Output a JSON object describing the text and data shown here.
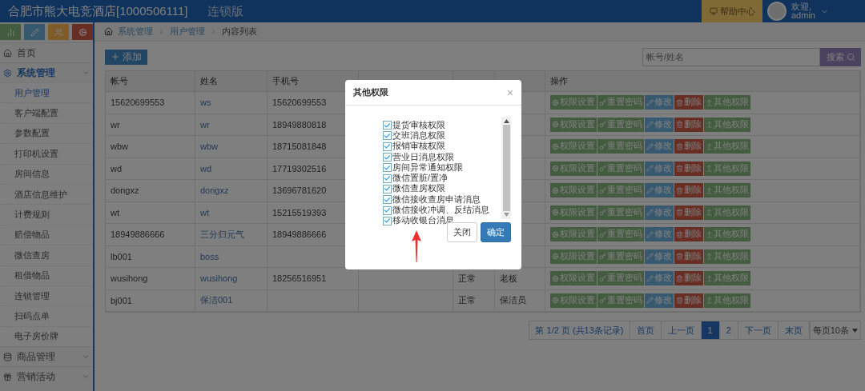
{
  "header": {
    "title": "合肥市熊大电竞酒店[1000506111]",
    "edition": "连锁版",
    "help": "帮助中心",
    "welcome": "欢迎,",
    "user": "admin"
  },
  "sidebar": {
    "shortcuts": [
      {
        "kind": "chart"
      },
      {
        "kind": "pencil"
      },
      {
        "kind": "users"
      },
      {
        "kind": "gears"
      }
    ],
    "items": [
      {
        "kind": "home",
        "label": "首页",
        "expanded": false
      },
      {
        "kind": "gear",
        "label": "系统管理",
        "expanded": true,
        "children": [
          {
            "label": "用户管理",
            "selected": true
          },
          {
            "label": "客户端配置",
            "selected": false
          },
          {
            "label": "参数配置",
            "selected": false
          },
          {
            "label": "打印机设置",
            "selected": false
          },
          {
            "label": "房间信息",
            "selected": false
          },
          {
            "label": "酒店信息维护",
            "selected": false
          },
          {
            "label": "计费规则",
            "selected": false
          },
          {
            "label": "赔偿物品",
            "selected": false
          },
          {
            "label": "微信查房",
            "selected": false
          },
          {
            "label": "租借物品",
            "selected": false
          },
          {
            "label": "连锁管理",
            "selected": false
          },
          {
            "label": "扫码点单",
            "selected": false
          },
          {
            "label": "电子房价牌",
            "selected": false
          }
        ]
      },
      {
        "kind": "database",
        "label": "商品管理",
        "expanded": false
      },
      {
        "kind": "gift",
        "label": "营销活动",
        "expanded": false
      }
    ]
  },
  "breadcrumb": [
    "系统管理",
    "用户管理",
    "内容列表"
  ],
  "add_button": "添加",
  "search": {
    "placeholder": "帐号/姓名",
    "button": "搜索"
  },
  "table": {
    "columns": [
      "帐号",
      "姓名",
      "手机号",
      "操作"
    ],
    "rows": [
      {
        "account": "15620699553",
        "name": "ws",
        "phone": "15620699553",
        "actions": [
          {
            "kind": "permissions",
            "label": "权限设置"
          },
          {
            "kind": "reset",
            "label": "重置密码"
          },
          {
            "kind": "edit",
            "label": "修改"
          },
          {
            "kind": "delete",
            "label": "删除"
          },
          {
            "kind": "other",
            "label": "其他权限"
          }
        ]
      },
      {
        "account": "wr",
        "name": "wr",
        "phone": "18949880818",
        "actions": [
          {
            "kind": "permissions",
            "label": "权限设置"
          },
          {
            "kind": "reset",
            "label": "重置密码"
          },
          {
            "kind": "edit",
            "label": "修改"
          },
          {
            "kind": "delete",
            "label": "删除"
          },
          {
            "kind": "other",
            "label": "其他权限"
          }
        ]
      },
      {
        "account": "wbw",
        "name": "wbw",
        "phone": "18715081848",
        "actions": [
          {
            "kind": "permissions",
            "label": "权限设置"
          },
          {
            "kind": "reset",
            "label": "重置密码"
          },
          {
            "kind": "edit",
            "label": "修改"
          },
          {
            "kind": "delete",
            "label": "删除"
          },
          {
            "kind": "other",
            "label": "其他权限"
          }
        ]
      },
      {
        "account": "wd",
        "name": "wd",
        "phone": "17719302516",
        "actions": [
          {
            "kind": "permissions",
            "label": "权限设置"
          },
          {
            "kind": "reset",
            "label": "重置密码"
          },
          {
            "kind": "edit",
            "label": "修改"
          },
          {
            "kind": "delete",
            "label": "删除"
          },
          {
            "kind": "other",
            "label": "其他权限"
          }
        ]
      },
      {
        "account": "dongxz",
        "name": "dongxz",
        "phone": "13696781620",
        "actions": [
          {
            "kind": "permissions",
            "label": "权限设置"
          },
          {
            "kind": "reset",
            "label": "重置密码"
          },
          {
            "kind": "edit",
            "label": "修改"
          },
          {
            "kind": "delete",
            "label": "删除"
          },
          {
            "kind": "other",
            "label": "其他权限"
          }
        ]
      },
      {
        "account": "wt",
        "name": "wt",
        "phone": "15215519393",
        "actions": [
          {
            "kind": "permissions",
            "label": "权限设置"
          },
          {
            "kind": "reset",
            "label": "重置密码"
          },
          {
            "kind": "edit",
            "label": "修改"
          },
          {
            "kind": "delete",
            "label": "删除"
          },
          {
            "kind": "other",
            "label": "其他权限"
          }
        ]
      },
      {
        "account": "18949886666",
        "name": "三分归元气",
        "phone": "18949886666",
        "actions": [
          {
            "kind": "permissions",
            "label": "权限设置"
          },
          {
            "kind": "reset",
            "label": "重置密码"
          },
          {
            "kind": "edit",
            "label": "修改"
          },
          {
            "kind": "delete",
            "label": "删除"
          },
          {
            "kind": "other",
            "label": "其他权限"
          }
        ]
      },
      {
        "account": "lb001",
        "name": "boss",
        "actions": [
          {
            "kind": "permissions",
            "label": "权限设置"
          },
          {
            "kind": "reset",
            "label": "重置密码"
          },
          {
            "kind": "edit",
            "label": "修改"
          },
          {
            "kind": "delete",
            "label": "删除"
          },
          {
            "kind": "other",
            "label": "其他权限"
          }
        ]
      },
      {
        "account": "wusihong",
        "name": "wusihong",
        "phone": "18256516951",
        "status": "正常",
        "role": "老板",
        "actions": [
          {
            "kind": "permissions",
            "label": "权限设置"
          },
          {
            "kind": "reset",
            "label": "重置密码"
          },
          {
            "kind": "edit",
            "label": "修改"
          },
          {
            "kind": "delete",
            "label": "删除"
          },
          {
            "kind": "other",
            "label": "其他权限"
          }
        ]
      },
      {
        "account": "bj001",
        "name": "保洁001",
        "status": "正常",
        "role": "保洁员",
        "actions": [
          {
            "kind": "permissions",
            "label": "权限设置"
          },
          {
            "kind": "reset",
            "label": "重置密码"
          },
          {
            "kind": "edit",
            "label": "修改"
          },
          {
            "kind": "delete",
            "label": "删除"
          },
          {
            "kind": "other",
            "label": "其他权限"
          }
        ]
      }
    ]
  },
  "pagination": {
    "info": "第 1/2 页 (共13条记录)",
    "pages": [
      {
        "label": "首页",
        "selected": false
      },
      {
        "label": "上一页",
        "selected": false
      },
      {
        "label": "1",
        "selected": true
      },
      {
        "label": "2",
        "selected": false
      },
      {
        "label": "下一页",
        "selected": false
      },
      {
        "label": "末页",
        "selected": false
      }
    ],
    "page_size": "每页10条"
  },
  "modal": {
    "title": "其他权限",
    "close_icon": "×",
    "options": [
      {
        "label": "提货审核权限",
        "checked": true
      },
      {
        "label": "交班消息权限",
        "checked": true
      },
      {
        "label": "报销审核权限",
        "checked": true
      },
      {
        "label": "营业日消息权限",
        "checked": true
      },
      {
        "label": "房间异常通知权限",
        "checked": true
      },
      {
        "label": "微信置脏/置净",
        "checked": true
      },
      {
        "label": "微信查房权限",
        "checked": true
      },
      {
        "label": "微信接收查房申请消息",
        "checked": true
      },
      {
        "label": "微信接收冲调、反结消息",
        "checked": true
      },
      {
        "label": "移动收银台消息",
        "checked": true
      }
    ],
    "buttons": [
      {
        "kind": "default",
        "label": "关闭"
      },
      {
        "kind": "primary",
        "label": "确定"
      }
    ]
  }
}
